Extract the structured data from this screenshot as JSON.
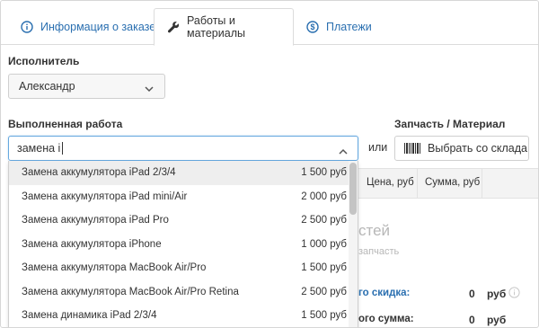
{
  "tabs": [
    {
      "label": "Информация о заказе",
      "icon": "info-circle-icon"
    },
    {
      "label": "Работы и материалы",
      "icon": "wrench-icon"
    },
    {
      "label": "Платежи",
      "icon": "dollar-circle-icon"
    }
  ],
  "executor": {
    "label": "Исполнитель",
    "value": "Александр"
  },
  "work": {
    "label": "Выполненная работа",
    "value": "замена i"
  },
  "part": {
    "label": "Запчасть / Материал",
    "or_text": "или",
    "stock_button_label": "Выбрать со склада"
  },
  "table": {
    "headers": [
      "Цена, руб",
      "Сумма, руб"
    ]
  },
  "empty": {
    "title": "стей",
    "subtitle": "запчасть"
  },
  "summary": {
    "discount_label": "го скидка:",
    "discount_value": "0",
    "discount_currency": "руб",
    "total_label": "ого сумма:",
    "total_value": "0",
    "total_currency": "руб"
  },
  "dropdown_options": [
    {
      "name": "Замена аккумулятора iPad 2/3/4",
      "price": "1 500 руб"
    },
    {
      "name": "Замена аккумулятора iPad mini/Air",
      "price": "2 000 руб"
    },
    {
      "name": "Замена аккумулятора iPad Pro",
      "price": "2 500 руб"
    },
    {
      "name": "Замена аккумулятора iPhone",
      "price": "1 000 руб"
    },
    {
      "name": "Замена аккумулятора MacBook Air/Pro",
      "price": "1 500 руб"
    },
    {
      "name": "Замена аккумулятора MacBook Air/Pro Retina",
      "price": "2 500 руб"
    },
    {
      "name": "Замена динамика iPad 2/3/4",
      "price": "1 500 руб"
    }
  ],
  "colors": {
    "accent": "#2a6fb0",
    "focus_border": "#66a8df",
    "highlight": "#eeeeee"
  }
}
